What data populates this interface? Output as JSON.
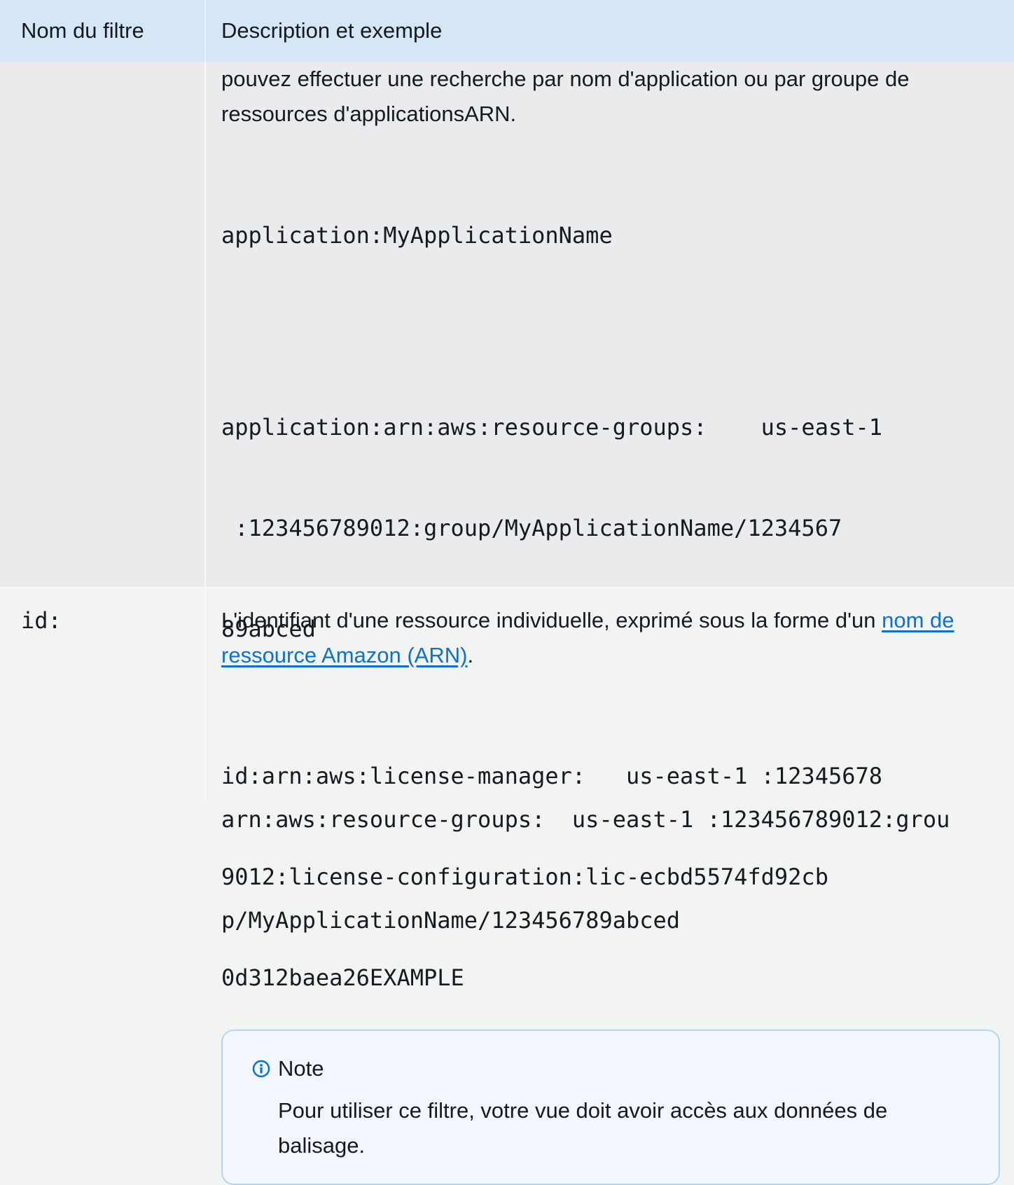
{
  "table": {
    "headers": {
      "filter_name": "Nom du filtre",
      "description": "Description et exemple"
    },
    "rows": [
      {
        "description": "pouvez effectuer une recherche par nom d'application ou par groupe de ressources d'applicationsARN.",
        "examples": [
          [
            "application:MyApplicationName"
          ],
          [
            "application:arn:aws:resource-groups:    us-east-1",
            " :123456789012:group/MyApplicationName/1234567",
            "89abced"
          ],
          [
            "arn:aws:resource-groups:  us-east-1 :123456789012:grou",
            "p/MyApplicationName/123456789abced"
          ]
        ],
        "note": {
          "icon": "info-icon",
          "title": "Note",
          "text": "Pour utiliser ce filtre, votre vue doit avoir accès aux données de balisage."
        }
      },
      {
        "filter_name": "id:",
        "description_text": "L'identifiant d'une ressource individuelle, exprimé sous la forme d'un ",
        "description_link": "nom de ressource Amazon (ARN)",
        "description_end": ".",
        "examples": [
          [
            "id:arn:aws:license-manager:   us-east-1 :12345678",
            "9012:license-configuration:lic-ecbd5574fd92cb",
            "0d312baea26EXAMPLE"
          ]
        ]
      }
    ]
  },
  "colors": {
    "header_bg": "#d5e7f7",
    "row_bg": "#e9ebed",
    "note_border": "#b1d6f6",
    "note_bg": "#f1f7fd",
    "info_icon": "#0972d3",
    "link": "#0972d3"
  }
}
